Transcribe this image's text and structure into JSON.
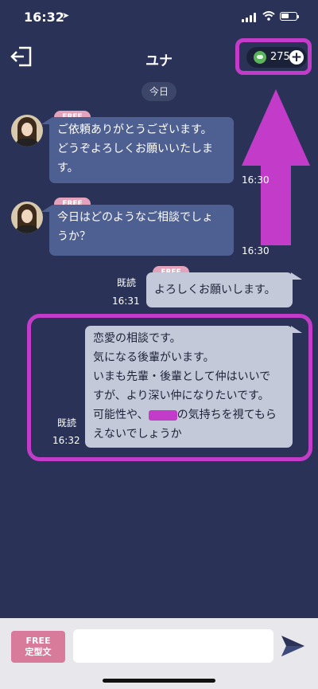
{
  "status_bar": {
    "time": "16:32"
  },
  "header": {
    "title": "ユナ",
    "points": "275"
  },
  "date_separator": "今日",
  "messages": [
    {
      "free_tag": "FREE",
      "lines": [
        "ご依頼ありがとうございます。",
        "どうぞよろしくお願いいたしま",
        "す。"
      ],
      "time": "16:30"
    },
    {
      "free_tag": "FREE",
      "lines": [
        "今日はどのようなご相談でしょ",
        "うか？"
      ],
      "time": "16:30"
    },
    {
      "free_tag": "FREE",
      "lines": [
        "よろしくお願いします。"
      ],
      "read": "既読",
      "time": "16:31"
    },
    {
      "lines": [
        "恋愛の相談です。",
        "気になる後輩がいます。",
        "いまも先輩・後輩として仲はいいで",
        "すが、より深い仲になりたいです。"
      ],
      "line5_before": "可能性や、",
      "line5_after": "の気持ちを視てもら",
      "line6": "えないでしょうか",
      "read": "既読",
      "time": "16:32"
    }
  ],
  "input_bar": {
    "template_top": "FREE",
    "template_bottom": "定型文",
    "placeholder": ""
  },
  "colors": {
    "background": "#2a3357",
    "incoming_bubble": "#4e5f92",
    "outgoing_bubble": "#c3c9d8",
    "highlight": "#c23bc9",
    "free_tag": "#e3a3bc"
  }
}
